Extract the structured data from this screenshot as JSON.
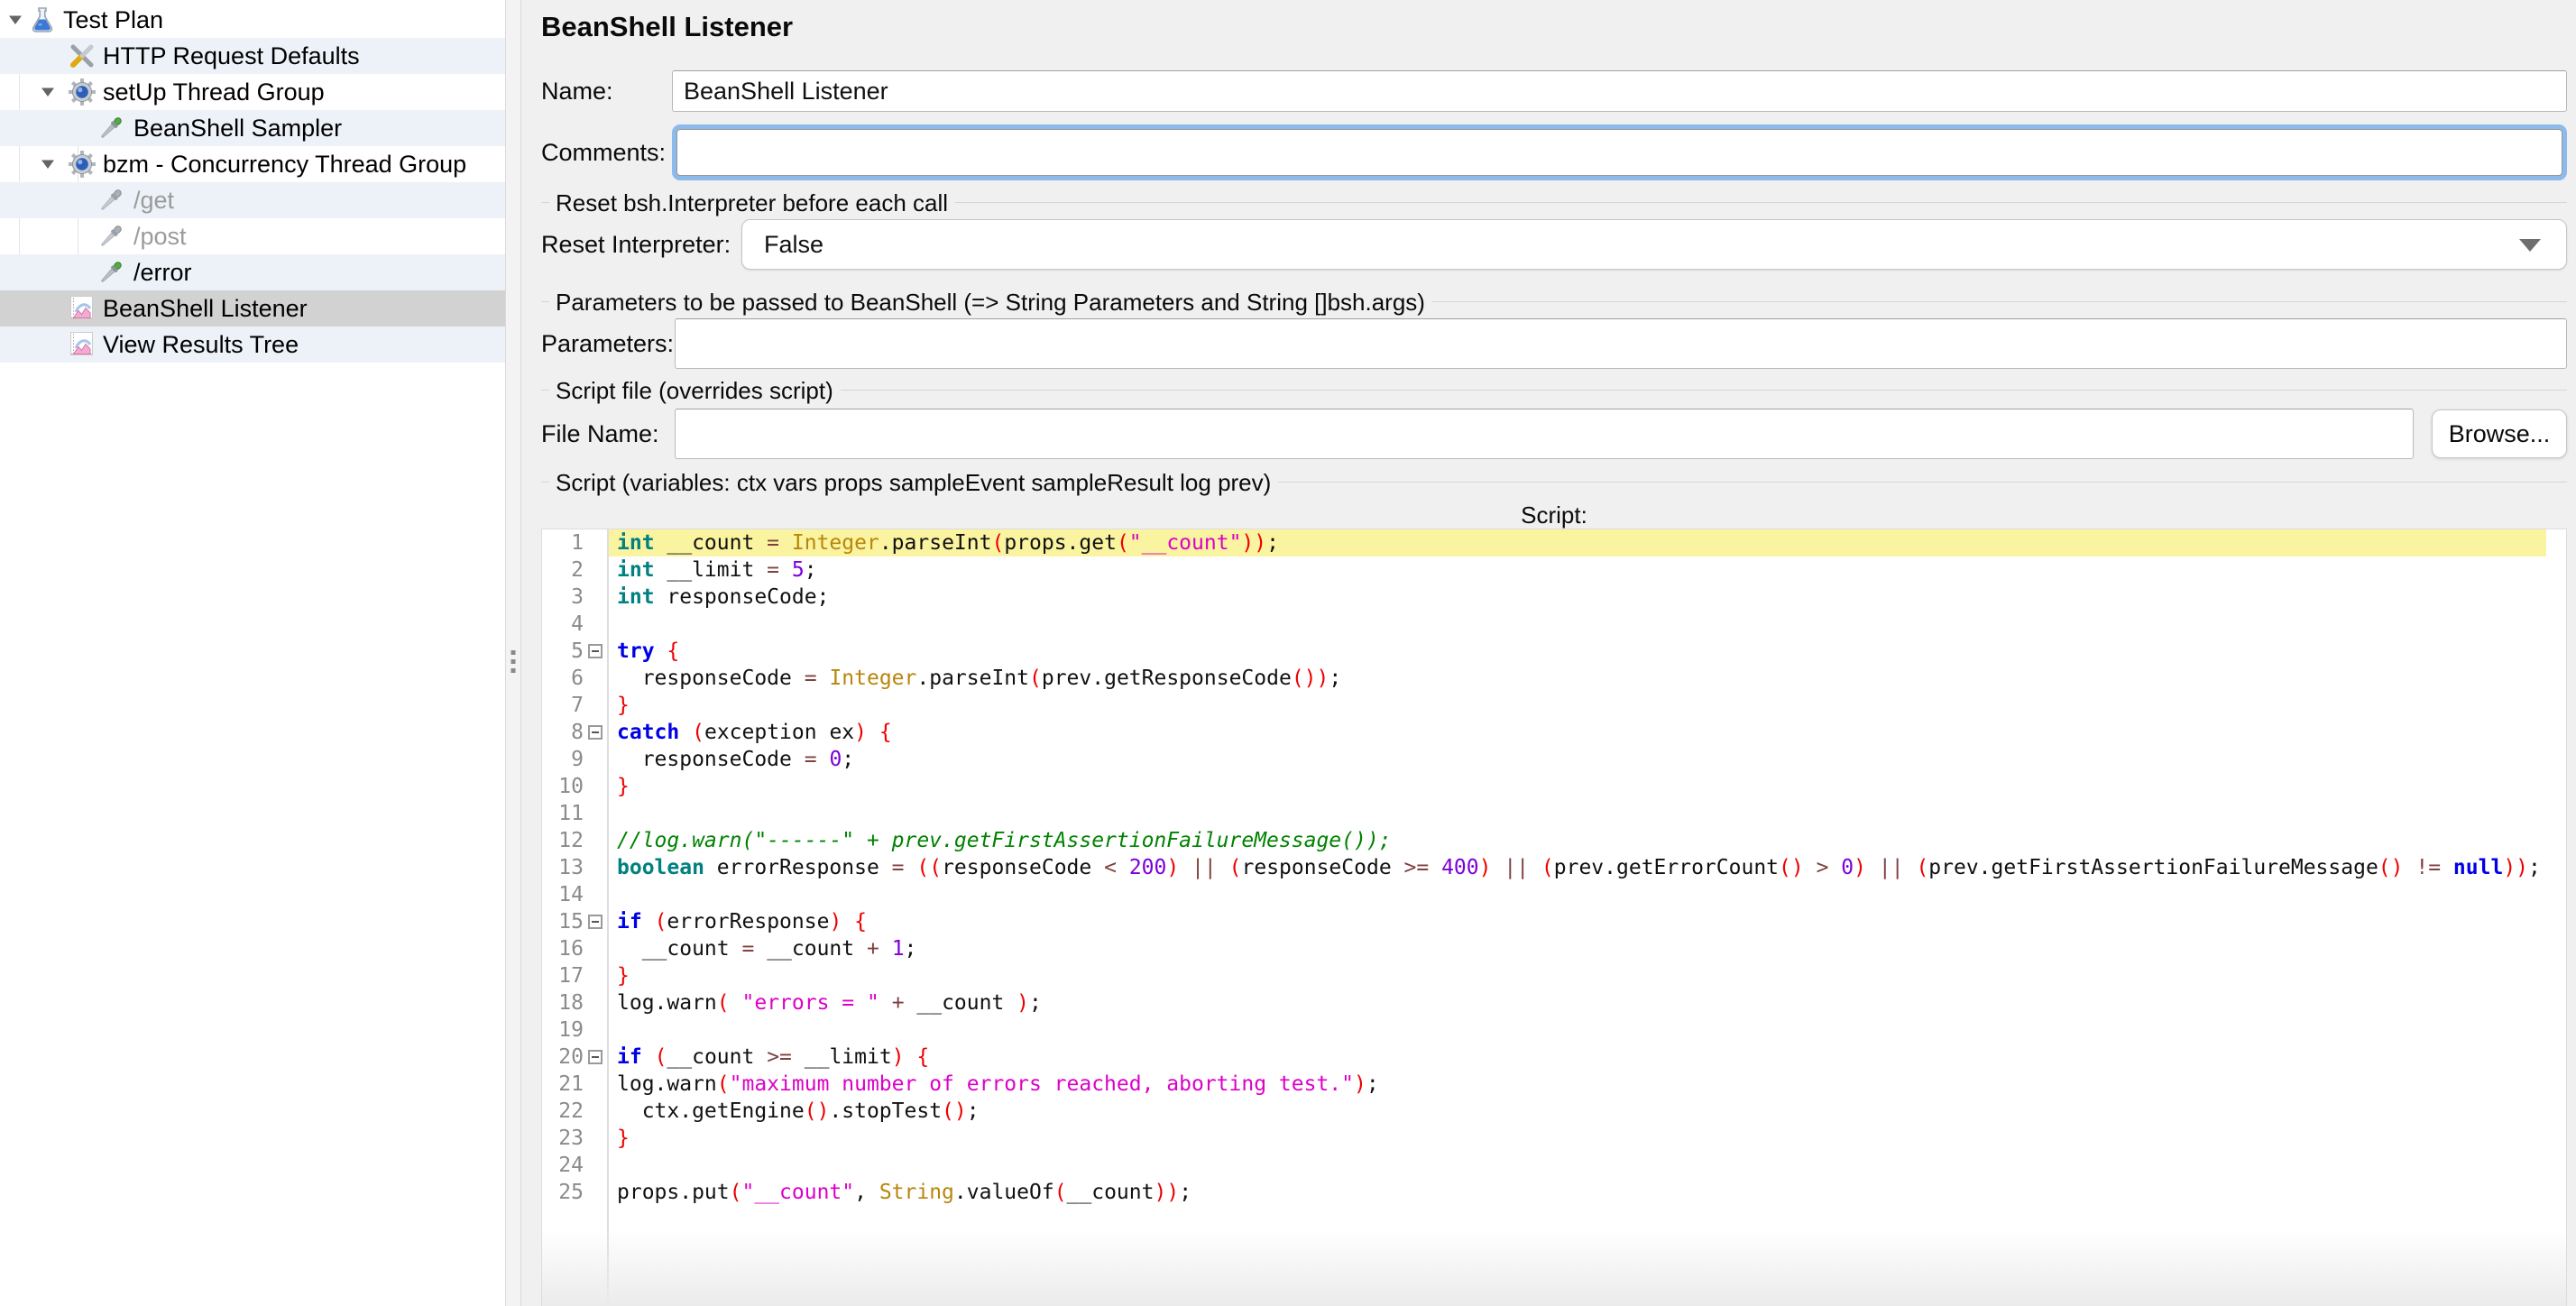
{
  "colors": {
    "panel_background": "#f0f0f0",
    "tree_row_stripe": "#edf2f9",
    "tree_selection": "#d2d2d2",
    "focus_ring": "#8cbaec",
    "current_line_highlight": "#faf3a0",
    "syntax": {
      "keyword": "#0000e6",
      "data_type": "#008080",
      "class_name": "#b8860b",
      "string": "#dc00c8",
      "number": "#7d00d9",
      "operator": "#804040",
      "separator": "#ee0000",
      "comment": "#008200",
      "plain": "#111111"
    }
  },
  "tree": {
    "items": [
      {
        "id": "test-plan",
        "label": "Test Plan",
        "icon": "test-plan-flask-icon",
        "level": 0,
        "expanded": true
      },
      {
        "id": "http-request-defaults",
        "label": "HTTP Request Defaults",
        "icon": "http-defaults-icon",
        "level": 1
      },
      {
        "id": "setup-thread-group",
        "label": "setUp Thread Group",
        "icon": "thread-group-gear-icon",
        "level": 1,
        "expanded": true
      },
      {
        "id": "beanshell-sampler",
        "label": "BeanShell Sampler",
        "icon": "sampler-enabled-icon",
        "level": 2
      },
      {
        "id": "bzm-concurrency-thread-group",
        "label": "bzm - Concurrency Thread Group",
        "icon": "thread-group-gear-icon",
        "level": 1,
        "expanded": true
      },
      {
        "id": "get",
        "label": "/get",
        "icon": "sampler-disabled-icon",
        "level": 2,
        "disabled": true
      },
      {
        "id": "post",
        "label": "/post",
        "icon": "sampler-disabled-icon",
        "level": 2,
        "disabled": true
      },
      {
        "id": "error",
        "label": "/error",
        "icon": "sampler-enabled-icon",
        "level": 2
      },
      {
        "id": "beanshell-listener",
        "label": "BeanShell Listener",
        "icon": "listener-chart-icon",
        "level": 1,
        "selected": true
      },
      {
        "id": "view-results-tree",
        "label": "View Results Tree",
        "icon": "listener-chart-icon",
        "level": 1
      }
    ]
  },
  "panel": {
    "title": "BeanShell Listener",
    "name": {
      "label": "Name:",
      "value": "BeanShell Listener"
    },
    "comments": {
      "label": "Comments:",
      "value": ""
    },
    "reset_group": "Reset bsh.Interpreter before each call",
    "reset": {
      "label": "Reset Interpreter:",
      "value": "False"
    },
    "params_group": "Parameters to be passed to BeanShell (=> String Parameters and String []bsh.args)",
    "parameters": {
      "label": "Parameters:",
      "value": ""
    },
    "file_group": "Script file (overrides script)",
    "file": {
      "label": "File Name:",
      "value": "",
      "browse": "Browse..."
    },
    "script_group": "Script (variables: ctx vars props sampleEvent sampleResult log prev)",
    "script_label": "Script:"
  },
  "editor": {
    "lines": [
      {
        "n": 1,
        "hl": true,
        "seg": [
          [
            "t",
            "int"
          ],
          [
            "x",
            " __count "
          ],
          [
            "o",
            "="
          ],
          [
            "x",
            " "
          ],
          [
            "c",
            "Integer"
          ],
          [
            "x",
            ".parseInt"
          ],
          [
            "p",
            "("
          ],
          [
            "x",
            "props.get"
          ],
          [
            "p",
            "("
          ],
          [
            "s",
            "\"__count\""
          ],
          [
            "p",
            "))"
          ],
          [
            "x",
            ";"
          ]
        ]
      },
      {
        "n": 2,
        "seg": [
          [
            "t",
            "int"
          ],
          [
            "x",
            " __limit "
          ],
          [
            "o",
            "="
          ],
          [
            "x",
            " "
          ],
          [
            "n",
            "5"
          ],
          [
            "x",
            ";"
          ]
        ]
      },
      {
        "n": 3,
        "seg": [
          [
            "t",
            "int"
          ],
          [
            "x",
            " responseCode;"
          ]
        ]
      },
      {
        "n": 4,
        "seg": []
      },
      {
        "n": 5,
        "fold": true,
        "seg": [
          [
            "k",
            "try"
          ],
          [
            "x",
            " "
          ],
          [
            "p",
            "{"
          ]
        ]
      },
      {
        "n": 6,
        "seg": [
          [
            "x",
            "  responseCode "
          ],
          [
            "o",
            "="
          ],
          [
            "x",
            " "
          ],
          [
            "c",
            "Integer"
          ],
          [
            "x",
            ".parseInt"
          ],
          [
            "p",
            "("
          ],
          [
            "x",
            "prev.getResponseCode"
          ],
          [
            "p",
            "())"
          ],
          [
            "x",
            ";"
          ]
        ]
      },
      {
        "n": 7,
        "seg": [
          [
            "p",
            "}"
          ]
        ]
      },
      {
        "n": 8,
        "fold": true,
        "seg": [
          [
            "k",
            "catch"
          ],
          [
            "x",
            " "
          ],
          [
            "p",
            "("
          ],
          [
            "x",
            "exception ex"
          ],
          [
            "p",
            ")"
          ],
          [
            "x",
            " "
          ],
          [
            "p",
            "{"
          ]
        ]
      },
      {
        "n": 9,
        "seg": [
          [
            "x",
            "  responseCode "
          ],
          [
            "o",
            "="
          ],
          [
            "x",
            " "
          ],
          [
            "n",
            "0"
          ],
          [
            "x",
            ";"
          ]
        ]
      },
      {
        "n": 10,
        "seg": [
          [
            "p",
            "}"
          ]
        ]
      },
      {
        "n": 11,
        "seg": []
      },
      {
        "n": 12,
        "seg": [
          [
            "m",
            "//log.warn(\"------\" + prev.getFirstAssertionFailureMessage());"
          ]
        ]
      },
      {
        "n": 13,
        "seg": [
          [
            "t",
            "boolean"
          ],
          [
            "x",
            " errorResponse "
          ],
          [
            "o",
            "="
          ],
          [
            "x",
            " "
          ],
          [
            "p",
            "(("
          ],
          [
            "x",
            "responseCode "
          ],
          [
            "o",
            "<"
          ],
          [
            "x",
            " "
          ],
          [
            "n",
            "200"
          ],
          [
            "p",
            ")"
          ],
          [
            "x",
            " "
          ],
          [
            "o",
            "||"
          ],
          [
            "x",
            " "
          ],
          [
            "p",
            "("
          ],
          [
            "x",
            "responseCode "
          ],
          [
            "o",
            ">="
          ],
          [
            "x",
            " "
          ],
          [
            "n",
            "400"
          ],
          [
            "p",
            ")"
          ],
          [
            "x",
            " "
          ],
          [
            "o",
            "||"
          ],
          [
            "x",
            " "
          ],
          [
            "p",
            "("
          ],
          [
            "x",
            "prev.getErrorCount"
          ],
          [
            "p",
            "()"
          ],
          [
            "x",
            " "
          ],
          [
            "o",
            ">"
          ],
          [
            "x",
            " "
          ],
          [
            "n",
            "0"
          ],
          [
            "p",
            ")"
          ],
          [
            "x",
            " "
          ],
          [
            "o",
            "||"
          ],
          [
            "x",
            " "
          ],
          [
            "p",
            "("
          ],
          [
            "x",
            "prev.getFirstAssertionFailureMessage"
          ],
          [
            "p",
            "()"
          ],
          [
            "x",
            " "
          ],
          [
            "o",
            "!="
          ],
          [
            "x",
            " "
          ],
          [
            "k",
            "null"
          ],
          [
            "p",
            "))"
          ],
          [
            "x",
            ";"
          ]
        ]
      },
      {
        "n": 14,
        "seg": []
      },
      {
        "n": 15,
        "fold": true,
        "seg": [
          [
            "k",
            "if"
          ],
          [
            "x",
            " "
          ],
          [
            "p",
            "("
          ],
          [
            "x",
            "errorResponse"
          ],
          [
            "p",
            ")"
          ],
          [
            "x",
            " "
          ],
          [
            "p",
            "{"
          ]
        ]
      },
      {
        "n": 16,
        "seg": [
          [
            "x",
            "  __count "
          ],
          [
            "o",
            "="
          ],
          [
            "x",
            " __count "
          ],
          [
            "o",
            "+"
          ],
          [
            "x",
            " "
          ],
          [
            "n",
            "1"
          ],
          [
            "x",
            ";"
          ]
        ]
      },
      {
        "n": 17,
        "seg": [
          [
            "p",
            "}"
          ]
        ]
      },
      {
        "n": 18,
        "seg": [
          [
            "x",
            "log.warn"
          ],
          [
            "p",
            "("
          ],
          [
            "x",
            " "
          ],
          [
            "s",
            "\"errors = \""
          ],
          [
            "x",
            " "
          ],
          [
            "o",
            "+"
          ],
          [
            "x",
            " __count "
          ],
          [
            "p",
            ")"
          ],
          [
            "x",
            ";"
          ]
        ]
      },
      {
        "n": 19,
        "seg": []
      },
      {
        "n": 20,
        "fold": true,
        "seg": [
          [
            "k",
            "if"
          ],
          [
            "x",
            " "
          ],
          [
            "p",
            "("
          ],
          [
            "x",
            "__count "
          ],
          [
            "o",
            ">="
          ],
          [
            "x",
            " __limit"
          ],
          [
            "p",
            ")"
          ],
          [
            "x",
            " "
          ],
          [
            "p",
            "{"
          ]
        ]
      },
      {
        "n": 21,
        "seg": [
          [
            "x",
            "log.warn"
          ],
          [
            "p",
            "("
          ],
          [
            "s",
            "\"maximum number of errors reached, aborting test.\""
          ],
          [
            "p",
            ")"
          ],
          [
            "x",
            ";"
          ]
        ]
      },
      {
        "n": 22,
        "seg": [
          [
            "x",
            "  ctx.getEngine"
          ],
          [
            "p",
            "()"
          ],
          [
            "x",
            ".stopTest"
          ],
          [
            "p",
            "()"
          ],
          [
            "x",
            ";"
          ]
        ]
      },
      {
        "n": 23,
        "seg": [
          [
            "p",
            "}"
          ]
        ]
      },
      {
        "n": 24,
        "seg": []
      },
      {
        "n": 25,
        "seg": [
          [
            "x",
            "props.put"
          ],
          [
            "p",
            "("
          ],
          [
            "s",
            "\"__count\""
          ],
          [
            "x",
            ", "
          ],
          [
            "c",
            "String"
          ],
          [
            "x",
            ".valueOf"
          ],
          [
            "p",
            "("
          ],
          [
            "x",
            "__count"
          ],
          [
            "p",
            "))"
          ],
          [
            "x",
            ";"
          ]
        ]
      }
    ]
  }
}
